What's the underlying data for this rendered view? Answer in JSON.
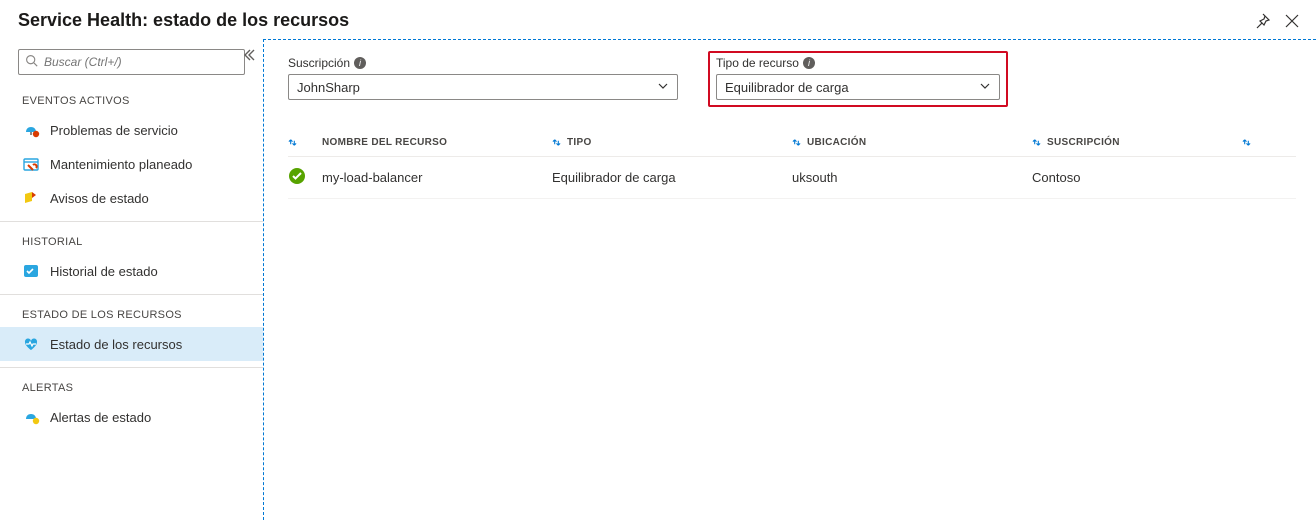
{
  "header": {
    "title": "Service Health: estado de los recursos"
  },
  "sidebar": {
    "search_placeholder": "Buscar (Ctrl+/)",
    "sections": {
      "activeEvents": "EVENTOS ACTIVOS",
      "history": "HISTORIAL",
      "resourceHealth": "ESTADO DE LOS RECURSOS",
      "alerts": "ALERTAS"
    },
    "items": {
      "serviceIssues": "Problemas de servicio",
      "plannedMaintenance": "Mantenimiento planeado",
      "healthAdvisories": "Avisos de estado",
      "healthHistory": "Historial de estado",
      "resourceHealth": "Estado de los recursos",
      "healthAlerts": "Alertas de estado"
    }
  },
  "filters": {
    "subscription": {
      "label": "Suscripción",
      "value": "JohnSharp"
    },
    "resourceType": {
      "label": "Tipo de recurso",
      "value": "Equilibrador de carga"
    }
  },
  "table": {
    "headers": {
      "name": "NOMBRE DEL RECURSO",
      "type": "TIPO",
      "location": "UBICACIÓN",
      "subscription": "SUSCRIPCIÓN"
    },
    "rows": [
      {
        "name": "my-load-balancer",
        "type": "Equilibrador de carga",
        "location": "uksouth",
        "subscription": "Contoso"
      }
    ]
  }
}
